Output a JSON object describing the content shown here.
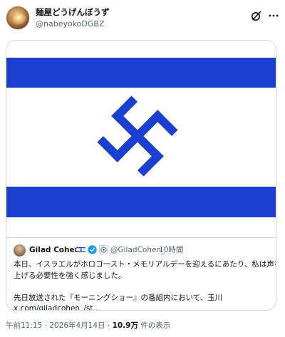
{
  "post": {
    "author_name": "麺屋どうげんぼうず",
    "author_handle": "@nabeyokoDGBZ",
    "icons": {
      "avatar": "ramen-avatar",
      "grok": "grok-icon",
      "more": "more-icon"
    }
  },
  "image": {
    "description_icon": "flag-image",
    "colors": {
      "blue": "#1a3fd1",
      "white": "#ffffff"
    }
  },
  "quote": {
    "author_name": "Gilad Cohen",
    "author_handle": "@GiladCohen_",
    "separator": "·",
    "time": "10時間",
    "lines": [
      "本日、イスラエルがホロコースト・メモリアルデーを迎えるにあたり、私は声を",
      "上げる必要性を強く感じました。",
      "",
      "先日放送された『モーニングショー』の番組内において、玉川",
      "x.com/giladcohen_/st..."
    ],
    "icons": {
      "flag": "israel-flag-icon",
      "verified": "verified-icon",
      "affiliate": "affiliate-badge-icon"
    }
  },
  "meta": {
    "time": "午前11:15",
    "separator1": " · ",
    "date": "2026年4月14日",
    "separator2": " · ",
    "views_count": "10.9万",
    "views_label": " 件の表示"
  },
  "colors": {
    "text": "#0f1419",
    "secondary": "#536471",
    "border": "#cfd9de",
    "verified": "#1d9bf0"
  }
}
